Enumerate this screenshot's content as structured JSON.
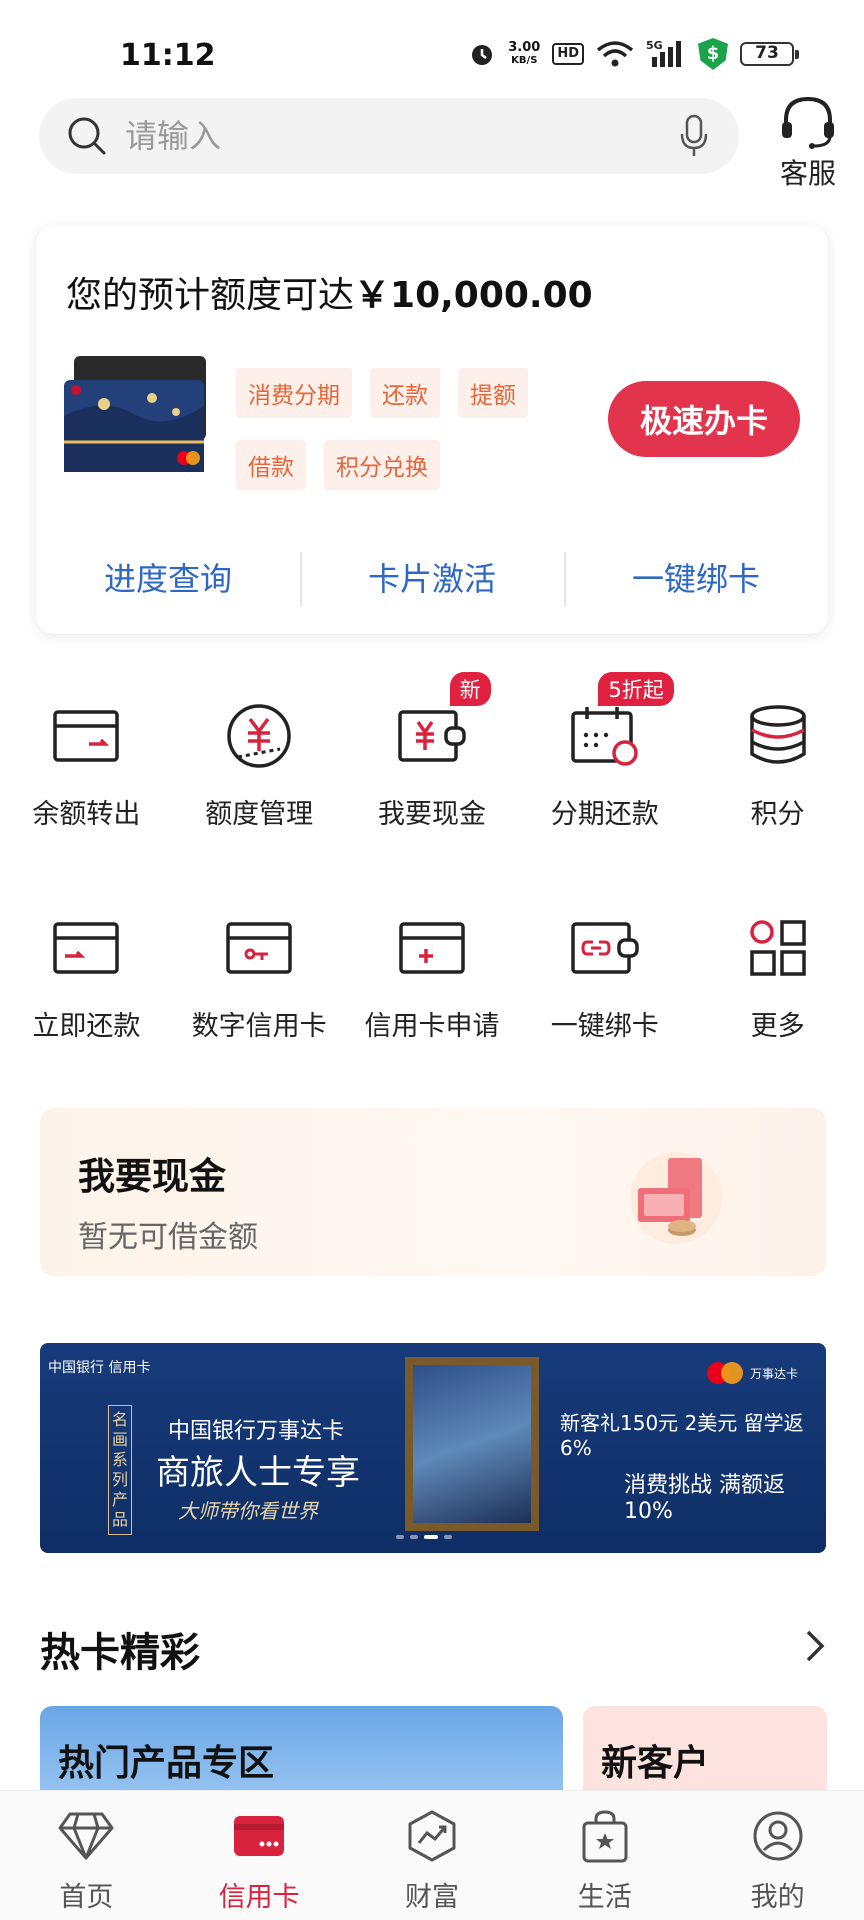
{
  "status_bar": {
    "time": "11:12",
    "speed": "3.00",
    "speed_unit": "KB/S",
    "hd": "HD",
    "network": "5G",
    "shield": "$",
    "battery": "73"
  },
  "search": {
    "placeholder": "请输入",
    "service_label": "客服"
  },
  "credit_card": {
    "title_prefix": "您的预计额度可达",
    "amount": "￥10,000.00",
    "tags": [
      "消费分期",
      "还款",
      "提额",
      "借款",
      "积分兑换"
    ],
    "apply_button": "极速办卡",
    "links": [
      "进度查询",
      "卡片激活",
      "一键绑卡"
    ]
  },
  "grid_row1": [
    {
      "label": "余额转出",
      "icon": "card-transfer-icon",
      "badge": ""
    },
    {
      "label": "额度管理",
      "icon": "yuan-circle-icon",
      "badge": ""
    },
    {
      "label": "我要现金",
      "icon": "wallet-yuan-icon",
      "badge": "新"
    },
    {
      "label": "分期还款",
      "icon": "calendar-icon",
      "badge": "5折起"
    },
    {
      "label": "积分",
      "icon": "coin-stack-icon",
      "badge": ""
    }
  ],
  "grid_row2": [
    {
      "label": "立即还款",
      "icon": "card-repay-icon"
    },
    {
      "label": "数字信用卡",
      "icon": "digital-card-icon"
    },
    {
      "label": "信用卡申请",
      "icon": "card-add-icon"
    },
    {
      "label": "一键绑卡",
      "icon": "card-link-icon"
    },
    {
      "label": "更多",
      "icon": "more-grid-icon"
    }
  ],
  "cash_panel": {
    "title": "我要现金",
    "subtitle": "暂无可借金额"
  },
  "banner": {
    "bank": "中国银行 信用卡",
    "series": "名画系列产品",
    "line1": "中国银行万事达卡",
    "line2": "商旅人士专享",
    "line3": "大师带你看世界",
    "brand": "万事达卡",
    "promo1": "新客礼150元  2美元  留学返6%",
    "promo2": "消费挑战  满额返10%"
  },
  "hot": {
    "title": "热卡精彩",
    "card1": "热门产品专区",
    "card2": "新客户"
  },
  "tabbar": [
    {
      "label": "首页",
      "icon": "diamond-icon",
      "active": false
    },
    {
      "label": "信用卡",
      "icon": "credit-card-icon",
      "active": true
    },
    {
      "label": "财富",
      "icon": "chart-icon",
      "active": false
    },
    {
      "label": "生活",
      "icon": "shopping-bag-icon",
      "active": false
    },
    {
      "label": "我的",
      "icon": "user-icon",
      "active": false
    }
  ],
  "colors": {
    "accent": "#e3344d",
    "link": "#2f68c4",
    "tag_text": "#e4663b"
  }
}
